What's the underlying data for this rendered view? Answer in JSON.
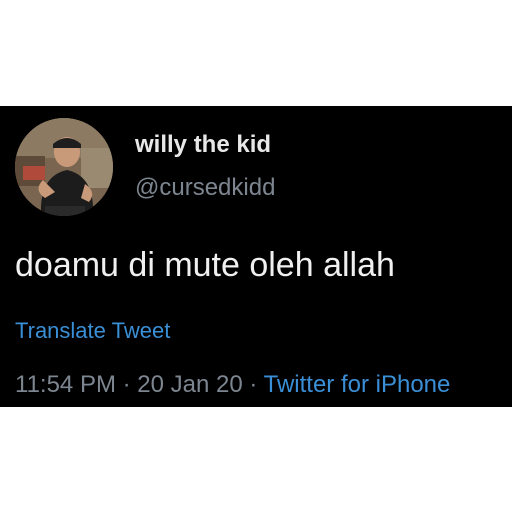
{
  "tweet": {
    "display_name": "willy the kid",
    "handle": "@cursedkidd",
    "text": "doamu di mute oleh allah",
    "translate_label": "Translate Tweet",
    "time": "11:54 PM",
    "separator": " · ",
    "date": "20 Jan 20",
    "source": "Twitter for iPhone"
  },
  "colors": {
    "card_background": "#000000",
    "page_background": "#ffffff",
    "link_blue": "#3a8fd6",
    "secondary_text": "#7d8690",
    "primary_text": "#f0f0f0"
  },
  "icons": {
    "avatar": "profile-photo"
  }
}
